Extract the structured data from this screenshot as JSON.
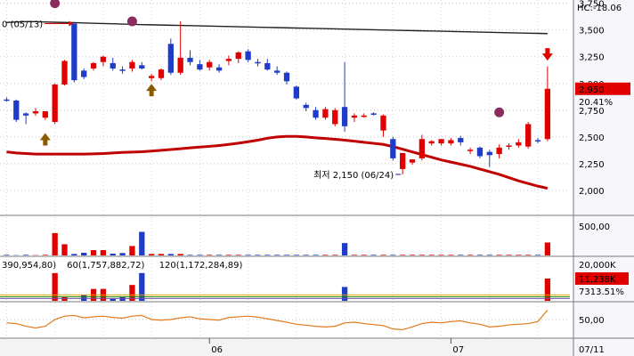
{
  "chart_data": [
    {
      "type": "candlestick",
      "pane": "price",
      "title": "",
      "yaxis": {
        "side": "right",
        "ylim": [
          1800,
          3780
        ],
        "ticks": [
          2000,
          2250,
          2500,
          2750,
          3000,
          3250,
          3500,
          3750
        ],
        "tick_labels": [
          "2,000",
          "2,250",
          "2,500",
          "2,750",
          "3,000",
          "3,250",
          "3,500",
          "3,750"
        ]
      },
      "ohlc": [
        [
          2850,
          2870,
          2830,
          2840
        ],
        [
          2840,
          2850,
          2640,
          2660
        ],
        [
          2720,
          2730,
          2620,
          2700
        ],
        [
          2720,
          2770,
          2700,
          2740
        ],
        [
          2680,
          2740,
          2660,
          2740
        ],
        [
          2640,
          3000,
          2620,
          2990
        ],
        [
          2990,
          3220,
          2980,
          3210
        ],
        [
          3560,
          3560,
          3010,
          3030
        ],
        [
          3120,
          3140,
          3040,
          3060
        ],
        [
          3140,
          3200,
          3120,
          3190
        ],
        [
          3200,
          3260,
          3160,
          3250
        ],
        [
          3190,
          3240,
          3120,
          3140
        ],
        [
          3130,
          3160,
          3090,
          3120
        ],
        [
          3140,
          3220,
          3110,
          3200
        ],
        [
          3170,
          3200,
          3130,
          3140
        ],
        [
          3050,
          3090,
          3020,
          3070
        ],
        [
          3050,
          3140,
          3030,
          3130
        ],
        [
          3370,
          3420,
          3080,
          3100
        ],
        [
          3100,
          3580,
          3080,
          3240
        ],
        [
          3240,
          3310,
          3170,
          3200
        ],
        [
          3180,
          3220,
          3120,
          3130
        ],
        [
          3150,
          3220,
          3120,
          3200
        ],
        [
          3150,
          3180,
          3100,
          3120
        ],
        [
          3210,
          3260,
          3170,
          3230
        ],
        [
          3230,
          3300,
          3190,
          3290
        ],
        [
          3300,
          3320,
          3200,
          3220
        ],
        [
          3200,
          3230,
          3160,
          3190
        ],
        [
          3190,
          3230,
          3120,
          3130
        ],
        [
          3120,
          3160,
          3080,
          3100
        ],
        [
          3100,
          3110,
          2990,
          3020
        ],
        [
          2970,
          2980,
          2850,
          2860
        ],
        [
          2800,
          2820,
          2740,
          2770
        ],
        [
          2750,
          2780,
          2660,
          2680
        ],
        [
          2680,
          2780,
          2660,
          2760
        ],
        [
          2620,
          2770,
          2600,
          2750
        ],
        [
          2780,
          3200,
          2550,
          2600
        ],
        [
          2680,
          2720,
          2640,
          2700
        ],
        [
          2700,
          2720,
          2680,
          2700
        ],
        [
          2720,
          2730,
          2700,
          2710
        ],
        [
          2560,
          2710,
          2500,
          2700
        ],
        [
          2480,
          2500,
          2280,
          2300
        ],
        [
          2200,
          2300,
          2150,
          2350
        ],
        [
          2260,
          2280,
          2240,
          2290
        ],
        [
          2300,
          2520,
          2280,
          2480
        ],
        [
          2440,
          2470,
          2420,
          2460
        ],
        [
          2440,
          2480,
          2420,
          2480
        ],
        [
          2440,
          2490,
          2420,
          2470
        ],
        [
          2490,
          2510,
          2420,
          2450
        ],
        [
          2370,
          2400,
          2340,
          2380
        ],
        [
          2400,
          2410,
          2300,
          2320
        ],
        [
          2360,
          2380,
          2220,
          2330
        ],
        [
          2340,
          2430,
          2300,
          2400
        ],
        [
          2420,
          2440,
          2380,
          2420
        ],
        [
          2420,
          2480,
          2400,
          2450
        ],
        [
          2410,
          2640,
          2390,
          2620
        ],
        [
          2470,
          2490,
          2440,
          2460
        ],
        [
          2480,
          3160,
          2460,
          2950
        ]
      ],
      "moving_averages": [
        {
          "name": "",
          "color": "#222222",
          "values": [
            3570,
            3575,
            3578,
            3578,
            3575,
            3572,
            3570,
            3568,
            3565,
            3562,
            3560,
            3558,
            3555,
            3553,
            3550,
            3548,
            3546,
            3544,
            3542,
            3540,
            3538,
            3536,
            3534,
            3532,
            3530,
            3528,
            3526,
            3524,
            3522,
            3520,
            3518,
            3516,
            3514,
            3512,
            3510,
            3508,
            3506,
            3504,
            3502,
            3500,
            3498,
            3496,
            3494,
            3492,
            3490,
            3488,
            3486,
            3484,
            3482,
            3480,
            3478,
            3476,
            3474,
            3472,
            3470,
            3468,
            3466
          ]
        },
        {
          "name": "",
          "color": "#c00000",
          "values": [
            2360,
            2350,
            2345,
            2340,
            2340,
            2340,
            2340,
            2340,
            2340,
            2342,
            2345,
            2350,
            2355,
            2358,
            2362,
            2368,
            2375,
            2382,
            2390,
            2398,
            2405,
            2412,
            2420,
            2430,
            2442,
            2455,
            2470,
            2488,
            2500,
            2505,
            2505,
            2500,
            2492,
            2485,
            2478,
            2470,
            2460,
            2450,
            2440,
            2430,
            2410,
            2385,
            2360,
            2335,
            2310,
            2285,
            2265,
            2245,
            2225,
            2200,
            2175,
            2150,
            2120,
            2090,
            2065,
            2040,
            2020
          ]
        }
      ],
      "markers": [
        {
          "type": "circle",
          "color": "#8b2c5e",
          "at_index": 5,
          "value": 3750
        },
        {
          "type": "circle",
          "color": "#8b2c5e",
          "at_index": 13,
          "value": 3580
        },
        {
          "type": "circle",
          "color": "#8b2c5e",
          "at_index": 51,
          "value": 2730
        },
        {
          "type": "arrow-up",
          "color": "#8b5a00",
          "at_index": 4,
          "value": 2470
        },
        {
          "type": "arrow-up",
          "color": "#8b5a00",
          "at_index": 15,
          "value": 2930
        },
        {
          "type": "arrow-down",
          "color": "#e00000",
          "at_index": 56,
          "value": 3280
        }
      ],
      "annotations": [
        {
          "id": "high",
          "text": "0 (05/13)",
          "color": "#e00000",
          "value": 3560
        },
        {
          "id": "low",
          "text": "최저 2,150 (06/24)",
          "color": "#1a237e",
          "value": 2150
        }
      ],
      "header_text": "HC:-18.06",
      "current_price": {
        "label": "2,950",
        "change": "20.41%",
        "color": "#e00000"
      },
      "x_axis": {
        "tick_labels": [
          "06",
          "07"
        ],
        "tick_indices": [
          21,
          46
        ],
        "right_label": "07/11"
      }
    },
    {
      "type": "bar",
      "pane": "volume",
      "yaxis": {
        "side": "right",
        "ticks": [
          500
        ],
        "tick_labels": [
          "500,00"
        ],
        "ylim": [
          0,
          650
        ]
      },
      "values": [
        10,
        5,
        10,
        5,
        10,
        380,
        190,
        25,
        45,
        90,
        90,
        30,
        40,
        160,
        400,
        25,
        25,
        25,
        25,
        10,
        10,
        10,
        10,
        10,
        10,
        10,
        10,
        10,
        10,
        10,
        10,
        10,
        10,
        10,
        10,
        210,
        10,
        10,
        10,
        10,
        10,
        10,
        10,
        10,
        10,
        10,
        10,
        10,
        10,
        10,
        10,
        10,
        10,
        10,
        10,
        10,
        220
      ],
      "colors_up": "#e00000",
      "colors_down": "#1e3cc8"
    },
    {
      "type": "bar",
      "pane": "volume_ma",
      "legend": [
        {
          "text": "390,954,80)",
          "color": "#d8a000"
        },
        {
          "text": "60(1,757,882,72)",
          "color": "#2e8b00"
        },
        {
          "text": "120(1,172,284,89)",
          "color": "#6d4fa8"
        }
      ],
      "yaxis": {
        "side": "right",
        "ticks": [
          20000
        ],
        "tick_labels": [
          "20,000K"
        ]
      },
      "values": [
        0,
        0,
        0,
        0,
        0,
        14000,
        2000,
        0,
        3000,
        6000,
        6000,
        1000,
        2000,
        8000,
        14000,
        0,
        0,
        0,
        0,
        0,
        0,
        0,
        0,
        0,
        0,
        0,
        0,
        0,
        0,
        0,
        0,
        0,
        0,
        0,
        0,
        7000,
        0,
        0,
        0,
        0,
        0,
        0,
        0,
        0,
        0,
        0,
        0,
        0,
        0,
        0,
        0,
        0,
        0,
        0,
        0,
        0,
        11238
      ],
      "last_value": "11,238K",
      "last_ratio": "7313.51%"
    },
    {
      "type": "line",
      "pane": "oscillator",
      "yaxis": {
        "side": "right",
        "ticks": [
          50
        ],
        "tick_labels": [
          "50,00"
        ],
        "ylim": [
          0,
          100
        ]
      },
      "color": "#e07a1a",
      "values": [
        40,
        38,
        30,
        25,
        30,
        50,
        60,
        62,
        55,
        58,
        60,
        56,
        54,
        60,
        62,
        50,
        48,
        50,
        55,
        58,
        52,
        50,
        48,
        56,
        58,
        60,
        57,
        52,
        47,
        42,
        36,
        33,
        30,
        28,
        30,
        40,
        42,
        38,
        35,
        32,
        22,
        20,
        28,
        38,
        42,
        40,
        44,
        46,
        40,
        36,
        28,
        30,
        34,
        36,
        38,
        44,
        78
      ]
    }
  ]
}
